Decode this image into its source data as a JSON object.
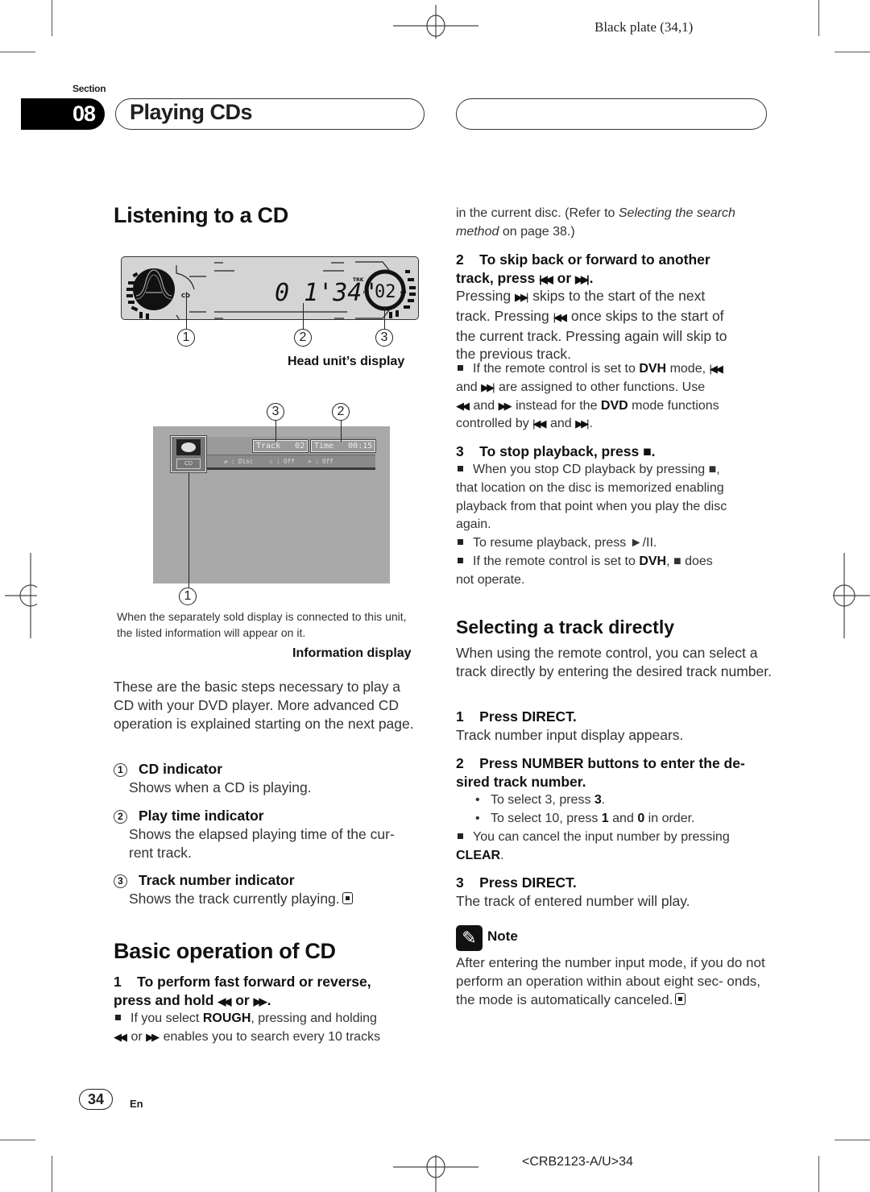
{
  "print_marks": {
    "plate": "Black plate (34,1)",
    "job_code": "<CRB2123-A/U>34"
  },
  "section": {
    "label": "Section",
    "number": "08",
    "title": "Playing CDs"
  },
  "left_column": {
    "listening_heading": "Listening to a CD",
    "head_unit_display": {
      "caption": "Head unit’s display",
      "time_readout": "0 1'34\"",
      "indicator_cd": "CD",
      "indicator_trk": "TRK",
      "track_readout": "02",
      "callouts": [
        "1",
        "2",
        "3"
      ]
    },
    "information_display": {
      "caption": "Information display",
      "track_label": "Track",
      "track_value": "02",
      "time_label": "Time",
      "time_value": "00:15",
      "cd_label": "CD",
      "sub_repeat": ": Disc",
      "sub_random": ": Off",
      "sub_scan": ": Off",
      "callouts_top": [
        "3",
        "2"
      ],
      "callout_bottom": "1",
      "note": "When the separately sold display is connected to this unit, the listed information will appear on it."
    },
    "intro": "These are the basic steps necessary to play a CD with your DVD player. More advanced CD operation is explained starting on the next page.",
    "indicators": [
      {
        "num": "1",
        "title": "CD indicator",
        "desc": "Shows when a CD is playing."
      },
      {
        "num": "2",
        "title": "Play time indicator",
        "desc_1": "Shows the elapsed playing time of the cur-",
        "desc_2": "rent track."
      },
      {
        "num": "3",
        "title": "Track number indicator",
        "desc": "Shows the track currently playing."
      }
    ],
    "basic_heading": "Basic operation of CD",
    "step1_line1": "1    To perform fast forward or reverse,",
    "step1_line2a": "press and hold",
    "step1_or": "or",
    "step1_note_a": "If you select",
    "step1_note_bold": "ROUGH",
    "step1_note_b": ", pressing and holding",
    "step1_note_c": "or",
    "step1_note_d": "enables you to search every 10 tracks"
  },
  "right_column": {
    "cont_1": "in the current disc. (Refer to",
    "cont_italic_1": "Selecting the search",
    "cont_italic_2": "method",
    "cont_2": "on page 38.)",
    "step2_line1": "2    To skip back or forward to another",
    "step2_line2a": "track, press",
    "step2_or": "or",
    "step2_p1a": "Pressing",
    "step2_p1b": "skips to the start of the next",
    "step2_p2a": "track. Pressing",
    "step2_p2b": "once skips to the start of",
    "step2_p3": "the current track. Pressing again will skip to",
    "step2_p4": "the previous track.",
    "step2_note_a": "If the remote control is set to",
    "step2_note_dvh": "DVH",
    "step2_note_b": "mode,",
    "step2_note_c": "and",
    "step2_note_d": "are assigned to other functions. Use",
    "step2_note_e": "and",
    "step2_note_f": "instead for the",
    "step2_note_dvd": "DVD",
    "step2_note_g": "mode functions",
    "step2_note_h": "controlled by",
    "step2_note_i": "and",
    "step3_heading": "3    To stop playback, press ■.",
    "step3_n1a": "When you stop CD playback by pressing ■,",
    "step3_n1b": "that location on the disc is memorized enabling",
    "step3_n1c": "playback from that point when you play the disc",
    "step3_n1d": "again.",
    "step3_n2": "To resume playback, press ►/II.",
    "step3_n3a": "If the remote control is set to",
    "step3_n3_dvh": "DVH",
    "step3_n3b": ",  ■ does",
    "step3_n3c": "not operate.",
    "select_heading": "Selecting a track directly",
    "select_intro": "When using the remote control, you can select a track directly by entering the desired track number.",
    "s1_heading": "1    Press DIRECT.",
    "s1_desc": "Track number input display appears.",
    "s2_heading_1": "2    Press NUMBER buttons to enter the de-",
    "s2_heading_2": "sired track number.",
    "s2_b1a": "To select 3, press",
    "s2_b1_bold": "3",
    "s2_b2a": "To select 10, press",
    "s2_b2_bold1": "1",
    "s2_b2_and": "and",
    "s2_b2_bold2": "0",
    "s2_b2b": "in order.",
    "s2_note_a": "You can cancel the input number by pressing",
    "s2_note_bold": "CLEAR",
    "s3_heading": "3    Press DIRECT.",
    "s3_desc": "The track of entered number will play.",
    "note_label": "Note",
    "note_text": "After entering the number input mode, if you do not perform an operation within about eight sec- onds, the mode is automatically canceled."
  },
  "footer": {
    "page_number": "34",
    "language": "En"
  },
  "icons": {
    "prev_track": "previous-track-icon",
    "next_track": "next-track-icon",
    "rewind": "rewind-icon",
    "fast_forward": "fast-forward-icon",
    "stop": "stop-icon",
    "play_pause": "play-pause-icon",
    "note": "pencil-note-icon",
    "end_mark": "end-of-section-icon"
  }
}
